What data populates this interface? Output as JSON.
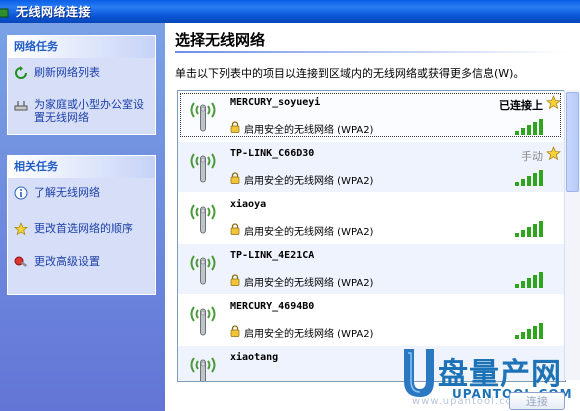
{
  "window": {
    "title": "无线网络连接"
  },
  "tasks_panel": {
    "header": "网络任务",
    "items": [
      {
        "label": "刷新网络列表",
        "icon": "refresh-icon"
      },
      {
        "label": "为家庭或小型办公室设置无线网络",
        "icon": "network-setup-icon"
      }
    ]
  },
  "related_panel": {
    "header": "相关任务",
    "items": [
      {
        "label": "了解无线网络",
        "icon": "info-icon"
      },
      {
        "label": "更改首选网络的顺序",
        "icon": "star-icon"
      },
      {
        "label": "更改高级设置",
        "icon": "settings-icon"
      }
    ]
  },
  "main": {
    "heading": "选择无线网络",
    "description": "单击以下列表中的项目以连接到区域内的无线网络或获得更多信息(W)。"
  },
  "networks": [
    {
      "ssid": "MERCURY_soyueyi",
      "security": "启用安全的无线网络 (WPA2)",
      "status": "已连接上",
      "preferred": true,
      "signal_bars": 5
    },
    {
      "ssid": "TP-LINK_C66D30",
      "security": "启用安全的无线网络 (WPA2)",
      "status": "手动",
      "preferred": true,
      "signal_bars": 5
    },
    {
      "ssid": "xiaoya",
      "security": "启用安全的无线网络 (WPA2)",
      "status": "",
      "preferred": false,
      "signal_bars": 5
    },
    {
      "ssid": "TP-LINK_4E21CA",
      "security": "启用安全的无线网络 (WPA2)",
      "status": "",
      "preferred": false,
      "signal_bars": 5
    },
    {
      "ssid": "MERCURY_4694B0",
      "security": "启用安全的无线网络 (WPA2)",
      "status": "",
      "preferred": false,
      "signal_bars": 5
    },
    {
      "ssid": "xiaotang",
      "security": "",
      "status": "",
      "preferred": false,
      "signal_bars": 0
    }
  ],
  "buttons": {
    "connect": "连接"
  },
  "watermark": {
    "text": "盘量产网",
    "url": "UPANTOOL.COM",
    "bottom": "www.upantool.com"
  },
  "colors": {
    "titlebar": "#0a5ee6",
    "link": "#1d3fa8",
    "accent": "#215dc6",
    "watermark": "#1e73b7",
    "signal": "#2fa51f"
  }
}
